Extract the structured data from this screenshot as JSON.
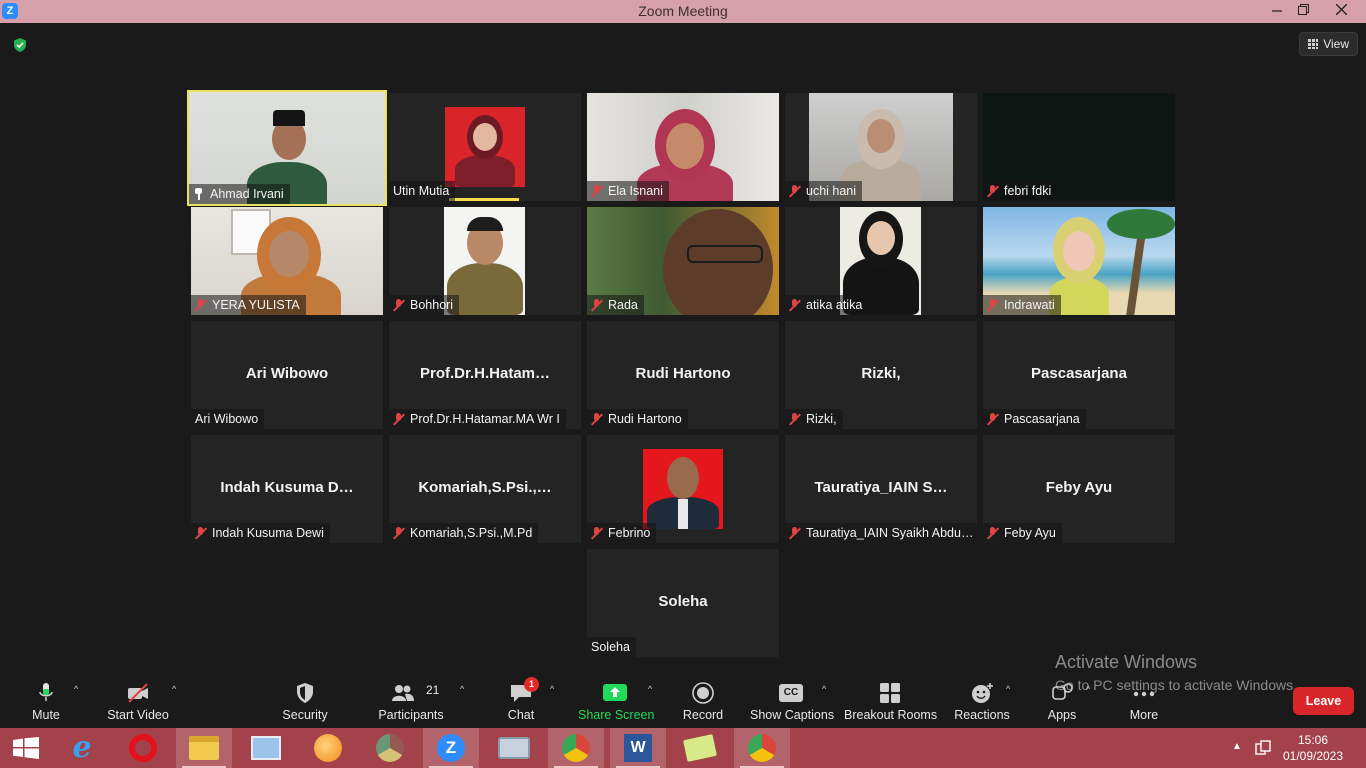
{
  "window": {
    "title": "Zoom Meeting",
    "minimize_icon": "minimize-icon",
    "restore_icon": "restore-icon",
    "close_icon": "close-icon"
  },
  "meeting": {
    "view_label": "View",
    "encryption_icon": "shield-check-icon",
    "tiles": [
      {
        "name": "Ahmad Irvani",
        "display": null,
        "video": true,
        "muted": false,
        "pinned": true,
        "active": true
      },
      {
        "name": "Utin Mutia",
        "display": null,
        "video": true,
        "muted": false,
        "pinned": false,
        "active": false
      },
      {
        "name": "Ela Isnani",
        "display": null,
        "video": true,
        "muted": true
      },
      {
        "name": "uchi hani",
        "display": null,
        "video": true,
        "muted": true
      },
      {
        "name": "febri fdki",
        "display": null,
        "video": true,
        "muted": true
      },
      {
        "name": "YERA YULISTA",
        "display": null,
        "video": true,
        "muted": true
      },
      {
        "name": "Bohhori",
        "display": null,
        "video": true,
        "muted": true
      },
      {
        "name": "Rada",
        "display": null,
        "video": true,
        "muted": true
      },
      {
        "name": "atika atika",
        "display": null,
        "video": true,
        "muted": true
      },
      {
        "name": "Indrawati",
        "display": null,
        "video": true,
        "muted": true
      },
      {
        "name": "Ari Wibowo",
        "display": "Ari Wibowo",
        "video": false,
        "muted": false
      },
      {
        "name": "Prof.Dr.H.Hatamar.MA Wr I",
        "display": "Prof.Dr.H.Hatam…",
        "video": false,
        "muted": true
      },
      {
        "name": "Rudi Hartono",
        "display": "Rudi Hartono",
        "video": false,
        "muted": true
      },
      {
        "name": "Rizki,",
        "display": "Rizki,",
        "video": false,
        "muted": true
      },
      {
        "name": "Pascasarjana",
        "display": "Pascasarjana",
        "video": false,
        "muted": true
      },
      {
        "name": "Indah Kusuma Dewi",
        "display": "Indah Kusuma D…",
        "video": false,
        "muted": true
      },
      {
        "name": "Komariah,S.Psi.,M.Pd",
        "display": "Komariah,S.Psi.,…",
        "video": false,
        "muted": true
      },
      {
        "name": "Febrino",
        "display": null,
        "video": true,
        "muted": true
      },
      {
        "name": "Tauratiya_IAIN Syaikh Abdu…",
        "display": "Tauratiya_IAIN S…",
        "video": false,
        "muted": true
      },
      {
        "name": "Feby Ayu",
        "display": "Feby Ayu",
        "video": false,
        "muted": true
      },
      {
        "name": "Soleha",
        "display": "Soleha",
        "video": false,
        "muted": false
      }
    ]
  },
  "toolbar": {
    "mute": {
      "label": "Mute",
      "icon": "microphone-icon"
    },
    "video": {
      "label": "Start Video",
      "icon": "video-off-icon"
    },
    "security": {
      "label": "Security",
      "icon": "shield-icon"
    },
    "participants": {
      "label": "Participants",
      "icon": "participants-icon",
      "count": "21"
    },
    "chat": {
      "label": "Chat",
      "icon": "chat-icon",
      "badge": "1"
    },
    "share": {
      "label": "Share Screen",
      "icon": "share-screen-icon",
      "color": "#23d959"
    },
    "record": {
      "label": "Record",
      "icon": "record-icon"
    },
    "captions": {
      "label": "Show Captions",
      "icon": "cc-icon",
      "glyph": "CC"
    },
    "breakout": {
      "label": "Breakout Rooms",
      "icon": "breakout-rooms-icon"
    },
    "reactions": {
      "label": "Reactions",
      "icon": "reactions-icon"
    },
    "apps": {
      "label": "Apps",
      "icon": "apps-icon"
    },
    "more": {
      "label": "More",
      "icon": "more-icon"
    },
    "leave": {
      "label": "Leave",
      "color": "#d9262b"
    }
  },
  "watermark": {
    "line1": "Activate Windows",
    "line2": "Go to PC settings to activate Windows."
  },
  "taskbar": {
    "apps": [
      "windows-start-icon",
      "internet-explorer-icon",
      "opera-icon",
      "file-explorer-icon",
      "control-panel-icon",
      "orange-app-icon",
      "chrome-icon",
      "zoom-icon",
      "keyboard-icon",
      "chrome-profile-u-icon",
      "word-icon",
      "folder-icon",
      "chrome-profile-i-icon"
    ],
    "time": "15:06",
    "date": "01/09/2023"
  }
}
